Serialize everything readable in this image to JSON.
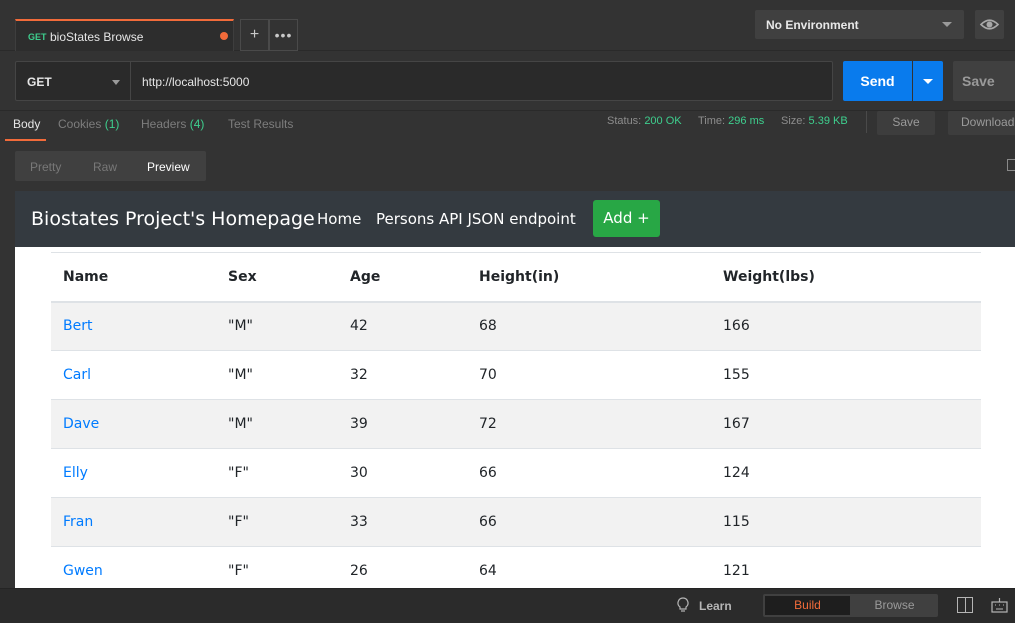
{
  "tab": {
    "method": "GET",
    "name": "bioStates Browse",
    "plus": "+",
    "more": "•••"
  },
  "environment": {
    "label": "No Environment",
    "icon": "eye-icon"
  },
  "request": {
    "method": "GET",
    "url": "http://localhost:5000",
    "send_label": "Send",
    "save_label": "Save"
  },
  "response_tabs": [
    {
      "label": "Body",
      "count": ""
    },
    {
      "label": "Cookies",
      "count": "(1)"
    },
    {
      "label": "Headers",
      "count": "(4)"
    },
    {
      "label": "Test Results",
      "count": ""
    }
  ],
  "response_meta": {
    "status_label": "Status:",
    "status_value": "200 OK",
    "time_label": "Time:",
    "time_value": "296 ms",
    "size_label": "Size:",
    "size_value": "5.39 KB",
    "save_label": "Save",
    "download_label": "Download"
  },
  "view_modes": [
    "Pretty",
    "Raw",
    "Preview"
  ],
  "preview": {
    "brand": "Biostates Project's Homepage",
    "nav": [
      "Home",
      "Persons API JSON endpoint"
    ],
    "add_label": "Add +",
    "columns": [
      "Name",
      "Sex",
      "Age",
      "Height(in)",
      "Weight(lbs)"
    ],
    "rows": [
      [
        "Bert",
        "\"M\"",
        "42",
        "68",
        "166"
      ],
      [
        "Carl",
        "\"M\"",
        "32",
        "70",
        "155"
      ],
      [
        "Dave",
        "\"M\"",
        "39",
        "72",
        "167"
      ],
      [
        "Elly",
        "\"F\"",
        "30",
        "66",
        "124"
      ],
      [
        "Fran",
        "\"F\"",
        "33",
        "66",
        "115"
      ],
      [
        "Gwen",
        "\"F\"",
        "26",
        "64",
        "121"
      ]
    ]
  },
  "statusbar": {
    "learn": "Learn",
    "build": "Build",
    "browse": "Browse"
  },
  "colors": {
    "accent": "#f26b3a",
    "send": "#097bed",
    "success": "#3ecf8e",
    "navbar": "#343a40",
    "add_button": "#28a745",
    "link": "#007bff"
  }
}
